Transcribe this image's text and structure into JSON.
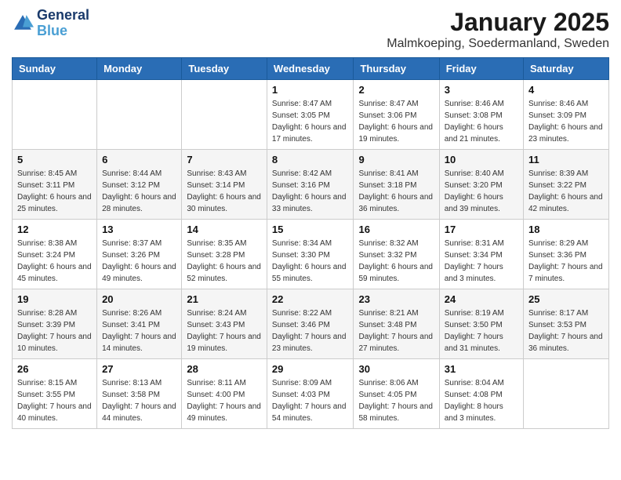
{
  "header": {
    "logo_line1": "General",
    "logo_line2": "Blue",
    "month_year": "January 2025",
    "location": "Malmkoeping, Soedermanland, Sweden"
  },
  "weekdays": [
    "Sunday",
    "Monday",
    "Tuesday",
    "Wednesday",
    "Thursday",
    "Friday",
    "Saturday"
  ],
  "weeks": [
    [
      {
        "day": "",
        "sunrise": "",
        "sunset": "",
        "daylight": ""
      },
      {
        "day": "",
        "sunrise": "",
        "sunset": "",
        "daylight": ""
      },
      {
        "day": "",
        "sunrise": "",
        "sunset": "",
        "daylight": ""
      },
      {
        "day": "1",
        "sunrise": "Sunrise: 8:47 AM",
        "sunset": "Sunset: 3:05 PM",
        "daylight": "Daylight: 6 hours and 17 minutes."
      },
      {
        "day": "2",
        "sunrise": "Sunrise: 8:47 AM",
        "sunset": "Sunset: 3:06 PM",
        "daylight": "Daylight: 6 hours and 19 minutes."
      },
      {
        "day": "3",
        "sunrise": "Sunrise: 8:46 AM",
        "sunset": "Sunset: 3:08 PM",
        "daylight": "Daylight: 6 hours and 21 minutes."
      },
      {
        "day": "4",
        "sunrise": "Sunrise: 8:46 AM",
        "sunset": "Sunset: 3:09 PM",
        "daylight": "Daylight: 6 hours and 23 minutes."
      }
    ],
    [
      {
        "day": "5",
        "sunrise": "Sunrise: 8:45 AM",
        "sunset": "Sunset: 3:11 PM",
        "daylight": "Daylight: 6 hours and 25 minutes."
      },
      {
        "day": "6",
        "sunrise": "Sunrise: 8:44 AM",
        "sunset": "Sunset: 3:12 PM",
        "daylight": "Daylight: 6 hours and 28 minutes."
      },
      {
        "day": "7",
        "sunrise": "Sunrise: 8:43 AM",
        "sunset": "Sunset: 3:14 PM",
        "daylight": "Daylight: 6 hours and 30 minutes."
      },
      {
        "day": "8",
        "sunrise": "Sunrise: 8:42 AM",
        "sunset": "Sunset: 3:16 PM",
        "daylight": "Daylight: 6 hours and 33 minutes."
      },
      {
        "day": "9",
        "sunrise": "Sunrise: 8:41 AM",
        "sunset": "Sunset: 3:18 PM",
        "daylight": "Daylight: 6 hours and 36 minutes."
      },
      {
        "day": "10",
        "sunrise": "Sunrise: 8:40 AM",
        "sunset": "Sunset: 3:20 PM",
        "daylight": "Daylight: 6 hours and 39 minutes."
      },
      {
        "day": "11",
        "sunrise": "Sunrise: 8:39 AM",
        "sunset": "Sunset: 3:22 PM",
        "daylight": "Daylight: 6 hours and 42 minutes."
      }
    ],
    [
      {
        "day": "12",
        "sunrise": "Sunrise: 8:38 AM",
        "sunset": "Sunset: 3:24 PM",
        "daylight": "Daylight: 6 hours and 45 minutes."
      },
      {
        "day": "13",
        "sunrise": "Sunrise: 8:37 AM",
        "sunset": "Sunset: 3:26 PM",
        "daylight": "Daylight: 6 hours and 49 minutes."
      },
      {
        "day": "14",
        "sunrise": "Sunrise: 8:35 AM",
        "sunset": "Sunset: 3:28 PM",
        "daylight": "Daylight: 6 hours and 52 minutes."
      },
      {
        "day": "15",
        "sunrise": "Sunrise: 8:34 AM",
        "sunset": "Sunset: 3:30 PM",
        "daylight": "Daylight: 6 hours and 55 minutes."
      },
      {
        "day": "16",
        "sunrise": "Sunrise: 8:32 AM",
        "sunset": "Sunset: 3:32 PM",
        "daylight": "Daylight: 6 hours and 59 minutes."
      },
      {
        "day": "17",
        "sunrise": "Sunrise: 8:31 AM",
        "sunset": "Sunset: 3:34 PM",
        "daylight": "Daylight: 7 hours and 3 minutes."
      },
      {
        "day": "18",
        "sunrise": "Sunrise: 8:29 AM",
        "sunset": "Sunset: 3:36 PM",
        "daylight": "Daylight: 7 hours and 7 minutes."
      }
    ],
    [
      {
        "day": "19",
        "sunrise": "Sunrise: 8:28 AM",
        "sunset": "Sunset: 3:39 PM",
        "daylight": "Daylight: 7 hours and 10 minutes."
      },
      {
        "day": "20",
        "sunrise": "Sunrise: 8:26 AM",
        "sunset": "Sunset: 3:41 PM",
        "daylight": "Daylight: 7 hours and 14 minutes."
      },
      {
        "day": "21",
        "sunrise": "Sunrise: 8:24 AM",
        "sunset": "Sunset: 3:43 PM",
        "daylight": "Daylight: 7 hours and 19 minutes."
      },
      {
        "day": "22",
        "sunrise": "Sunrise: 8:22 AM",
        "sunset": "Sunset: 3:46 PM",
        "daylight": "Daylight: 7 hours and 23 minutes."
      },
      {
        "day": "23",
        "sunrise": "Sunrise: 8:21 AM",
        "sunset": "Sunset: 3:48 PM",
        "daylight": "Daylight: 7 hours and 27 minutes."
      },
      {
        "day": "24",
        "sunrise": "Sunrise: 8:19 AM",
        "sunset": "Sunset: 3:50 PM",
        "daylight": "Daylight: 7 hours and 31 minutes."
      },
      {
        "day": "25",
        "sunrise": "Sunrise: 8:17 AM",
        "sunset": "Sunset: 3:53 PM",
        "daylight": "Daylight: 7 hours and 36 minutes."
      }
    ],
    [
      {
        "day": "26",
        "sunrise": "Sunrise: 8:15 AM",
        "sunset": "Sunset: 3:55 PM",
        "daylight": "Daylight: 7 hours and 40 minutes."
      },
      {
        "day": "27",
        "sunrise": "Sunrise: 8:13 AM",
        "sunset": "Sunset: 3:58 PM",
        "daylight": "Daylight: 7 hours and 44 minutes."
      },
      {
        "day": "28",
        "sunrise": "Sunrise: 8:11 AM",
        "sunset": "Sunset: 4:00 PM",
        "daylight": "Daylight: 7 hours and 49 minutes."
      },
      {
        "day": "29",
        "sunrise": "Sunrise: 8:09 AM",
        "sunset": "Sunset: 4:03 PM",
        "daylight": "Daylight: 7 hours and 54 minutes."
      },
      {
        "day": "30",
        "sunrise": "Sunrise: 8:06 AM",
        "sunset": "Sunset: 4:05 PM",
        "daylight": "Daylight: 7 hours and 58 minutes."
      },
      {
        "day": "31",
        "sunrise": "Sunrise: 8:04 AM",
        "sunset": "Sunset: 4:08 PM",
        "daylight": "Daylight: 8 hours and 3 minutes."
      },
      {
        "day": "",
        "sunrise": "",
        "sunset": "",
        "daylight": ""
      }
    ]
  ]
}
